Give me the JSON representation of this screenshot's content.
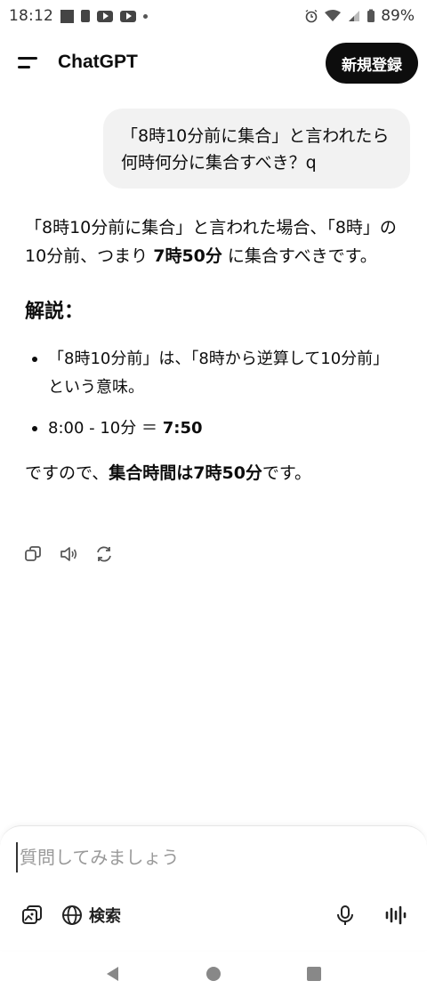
{
  "status_bar": {
    "time": "18:12",
    "battery": "89%"
  },
  "header": {
    "title": "ChatGPT",
    "signup_label": "新規登録"
  },
  "conversation": {
    "user_message": "「8時10分前に集合」と言われたら何時何分に集合すべき？q",
    "assistant": {
      "intro_part1": "「8時10分前に集合」と言われた場合、「8時」の10分前、つまり ",
      "intro_bold": "7時50分",
      "intro_part2": " に集合すべきです。",
      "heading": "解説：",
      "bullet1": "「8時10分前」は、「8時から逆算して10分前」という意味。",
      "bullet2_text": "8:00 - 10分 ＝ ",
      "bullet2_bold": "7:50",
      "conclusion_part1": "ですので、",
      "conclusion_bold": "集合時間は7時50分",
      "conclusion_part2": "です。"
    }
  },
  "composer": {
    "placeholder": "質問してみましょう",
    "search_label": "検索"
  },
  "icons": {
    "menu": "menu-icon",
    "copy": "copy-icon",
    "speaker": "speaker-icon",
    "regenerate": "regenerate-icon",
    "attach": "attach-image-icon",
    "globe": "globe-icon",
    "mic": "microphone-icon",
    "voice": "voice-mode-icon"
  }
}
